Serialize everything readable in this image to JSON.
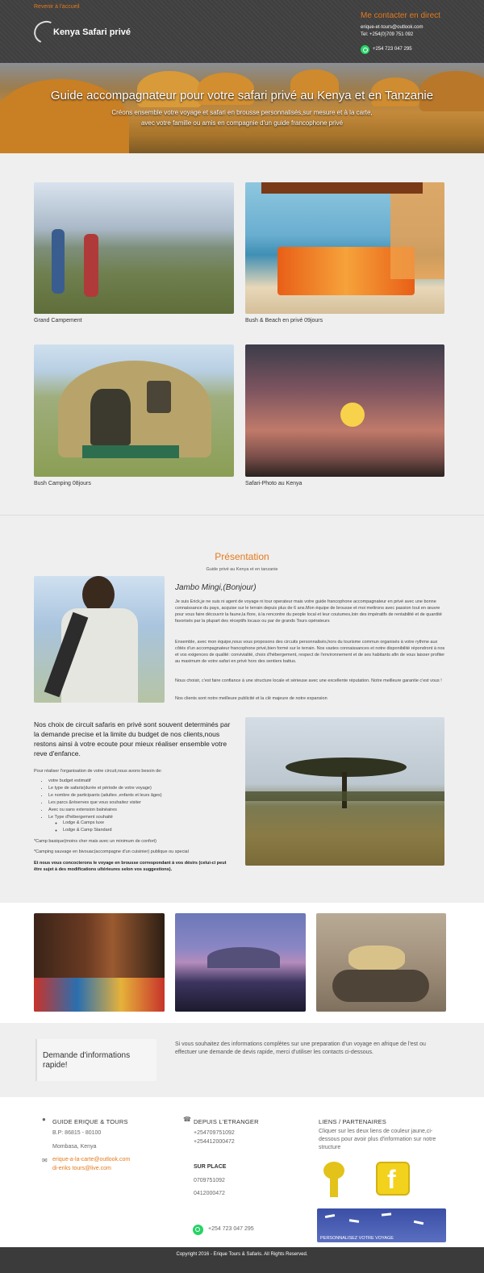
{
  "header": {
    "back_link": "Revenir à l'accueil",
    "logo_text": "Kenya Safari privé",
    "contact_title": "Me contacter en direct",
    "email": "erique-et-tours@outlook.com",
    "tel": "Tel: +254(0)709 751 092",
    "whatsapp": "+254 723 047 295",
    "accent_color": "#e47a1b"
  },
  "hero": {
    "title": "Guide accompagnateur pour votre safari privé au Kenya et en Tanzanie",
    "subtitle_line1": "Créons ensemble votre voyage et safari en brousse personnalisés,sur mesure et à la carte,",
    "subtitle_line2": "avec votre famille ou amis en compagnie d'un guide francophone privé"
  },
  "gallery": {
    "items": [
      {
        "caption": "Grand Campement"
      },
      {
        "caption": "Bush & Beach en privé 09jours"
      },
      {
        "caption": "Bush Camping 08jours"
      },
      {
        "caption": "Safari-Photo au Kenya"
      }
    ]
  },
  "presentation": {
    "title": "Présentation",
    "subtitle": "Guide privé au Kenya et en tanzanie",
    "greeting": "Jambo Mingi,(Bonjour)",
    "paragraphs": [
      "Je suis Erick,je ne suis ni agent de voyage ni tour operateur mais votre guide francophone accompagnateur en privé avec une bonne connaissance du pays, acquise sur le terrain depuis plus de 6 ans.Mon équipe de brousse et moi mettrons avec passion tout en œuvre pour vous faire découvrir la faune,la flore, à la rencontre du people local et leur coutumes,loin des impératifs de rentabilité et de quantité favorisés par la plupart des réceptifs locaux ou par de grands Tours opérateurs",
      "Ensemble, avec mon équipe,nous vous proposons des circuits personnalisés,hors du tourisme commun organisés à votre rythme aux côtés d'un accompagnateur francophone privé,bien formé sur le terrain. Nos vastes connaissances et notre disponibilité répondront à nos et vos exigences de qualité: convivialité, choix d'hébergement, respect de l'environnement et de ses habitants afin de vous laisser profiter au maximum de votre safari en privé hors des sentiers battus.",
      "Nous choisir, c'est faire confiance à une structure locale et sérieuse avec une excellente réputation. Notre meilleure garantie c'est vous !",
      "Nos clients sont notre meilleure publicité et la clé majeure de notre expansion"
    ]
  },
  "circuits": {
    "heading": "Nos choix de circuit safaris en privé sont souvent determinés par la demande precise et la limite du budget de nos clients,nous restons ainsi à votre ecoute pour mieux réaliser ensemble votre reve d'enfance.",
    "intro": "Pour réaliser l'organisation de votre circuit,nous avons besoin de:",
    "needs": [
      "votre budget estimatif",
      "Le type de safaris(durée et période de votre voyage)",
      "Le nombre de participants (adultes ,enfants et leurs âges)",
      "Les parcs &réserves que vous souhaitez visiter",
      "Avec ou sans extension balnéaires",
      "Le Type d'hébergement souhaité"
    ],
    "lodging": [
      "Lodge & Camps luxe",
      "Lodge & Camp Standard"
    ],
    "note1": "*Camp basique(moins cher mais avec un minimum de confort)",
    "note2": "*Camping sauvage en bivouac(accompagne d'un cuisinier) publique ou special",
    "bold_note": "Et nous vous concocterons le voyage en brousse correspondant à vos désirs (celui-ci peut être sujet à des modifications ultérieures selon vos suggestions)."
  },
  "quick": {
    "title": "Demande d'informations rapide!",
    "text": "Si vous souhaitez des informations complètes sur une preparation d'un voyage en afrique de l'est ou effectuer une demande de devis rapide, merci d'utiliser les contacts ci-dessous."
  },
  "footer": {
    "col1": {
      "title": "GUIDE ERIQUE & TOURS",
      "address1": "B.P: 86815 - 80100",
      "address2": "Mombasa, Kenya",
      "email1": "erique-a-la-carte@outlook.com",
      "email2": "di-eriks tours@live.com"
    },
    "col2": {
      "title": "DEPUIS L'ETRANGER",
      "phone1": "+254709751092",
      "phone2": "+254412000472",
      "sub_title": "SUR PLACE",
      "local1": "0709751092",
      "local2": "0412000472"
    },
    "col3": {
      "title": "LIENS / PARTENAIRES",
      "text": "Cliquer sur les deux liens de couleur jaune,ci-dessous pour avoir plus d'information sur notre structure"
    },
    "whatsapp": "+254 723 047 295",
    "banner_text": "PERSONNALISEZ VOTRE VOYAGE",
    "copyright": "Copyright 2016 - Erique Tours & Safaris. All Rights Reserved."
  }
}
